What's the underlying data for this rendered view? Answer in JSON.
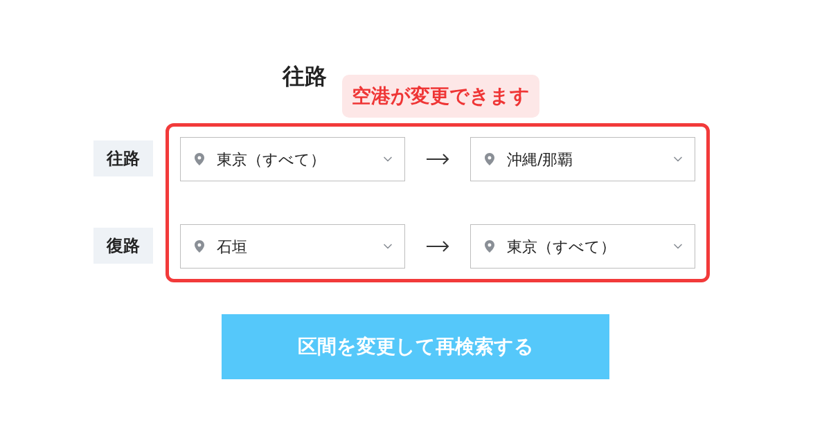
{
  "title": "往路",
  "callout": "空港が変更できます",
  "legs": [
    {
      "label": "往路",
      "from": "東京（すべて）",
      "to": "沖縄/那覇"
    },
    {
      "label": "復路",
      "from": "石垣",
      "to": "東京（すべて）"
    }
  ],
  "submit": "区間を変更して再検索する"
}
